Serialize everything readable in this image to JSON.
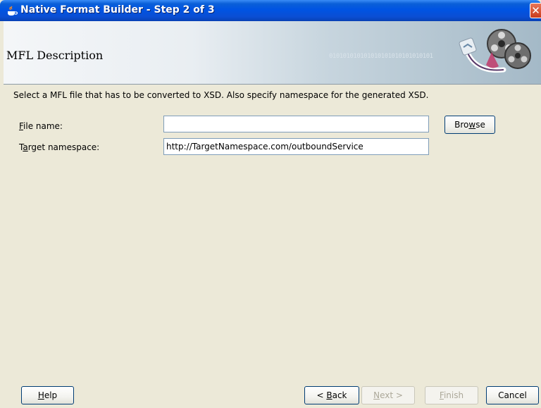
{
  "window": {
    "title": "Native Format Builder - Step 2 of 3",
    "close_glyph": "✕"
  },
  "banner": {
    "title": "MFL Description",
    "binary_text": "010101010101010101010101010101"
  },
  "instruction": "Select a MFL file that has to be converted to XSD. Also specify namespace  for the generated XSD.",
  "fields": {
    "file_name": {
      "label_mnemonic": "F",
      "label_rest": "ile name:",
      "value": ""
    },
    "target_namespace": {
      "label_prefix": "T",
      "label_mnemonic": "a",
      "label_rest": "rget namespace:",
      "value": "http://TargetNamespace.com/outboundService"
    }
  },
  "buttons": {
    "browse": {
      "pre": "Bro",
      "mnemonic": "w",
      "post": "se"
    },
    "help": {
      "mnemonic": "H",
      "post": "elp"
    },
    "back": {
      "pre": "< ",
      "mnemonic": "B",
      "post": "ack"
    },
    "next": {
      "mnemonic": "N",
      "post": "ext >"
    },
    "finish": {
      "mnemonic": "F",
      "post": "inish"
    },
    "cancel": "Cancel"
  },
  "colors": {
    "title_bar": "#0054e3",
    "dialog_background": "#ece9d8",
    "input_border": "#7f9db9",
    "button_border": "#003c74",
    "disabled_text": "#aca899"
  },
  "icons": {
    "title": "oracle-cup-icon",
    "banner": "film-reel-icon",
    "close": "close-icon"
  }
}
